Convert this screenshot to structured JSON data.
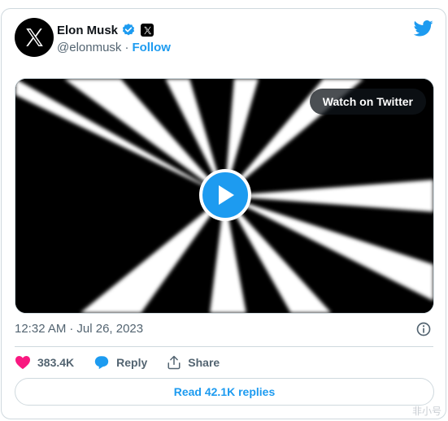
{
  "author": {
    "name": "Elon Musk",
    "handle": "@elonmusk",
    "separator": "·",
    "follow_label": "Follow",
    "avatar_icon": "x-logo-icon",
    "verified_icon": "verified-badge-icon",
    "affiliation_icon": "x-affiliation-icon"
  },
  "brand_icon": "twitter-bird-icon",
  "media": {
    "watch_label": "Watch on Twitter",
    "play_icon": "play-icon"
  },
  "meta": {
    "time": "12:32 AM",
    "separator": "·",
    "date": "Jul 26, 2023",
    "info_icon": "info-icon"
  },
  "actions": {
    "likes": "383.4K",
    "reply_label": "Reply",
    "share_label": "Share"
  },
  "read_replies_label": "Read 42.1K replies",
  "watermark": "非小号",
  "colors": {
    "accent": "#1d9bf0",
    "like": "#f91880",
    "text": "#0f1419",
    "muted": "#536471"
  }
}
